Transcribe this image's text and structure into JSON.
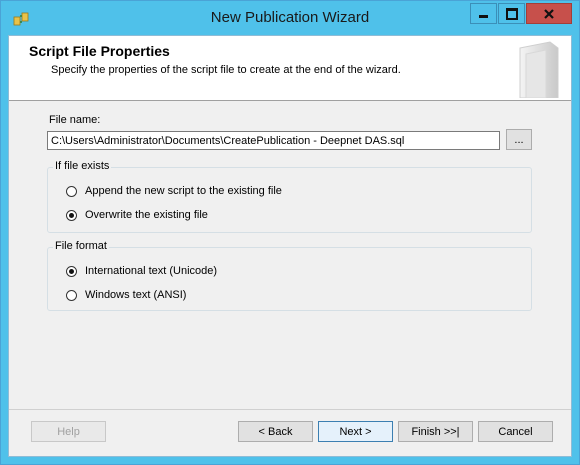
{
  "window": {
    "title": "New Publication Wizard",
    "icon": "sql-server-replication-icon"
  },
  "header": {
    "title": "Script File Properties",
    "subtitle": "Specify the properties of the script file to create at the end of the wizard."
  },
  "file": {
    "label": "File name:",
    "value": "C:\\Users\\Administrator\\Documents\\CreatePublication - Deepnet DAS.sql",
    "browse_label": "..."
  },
  "if_exists": {
    "legend": "If file exists",
    "options": [
      {
        "label": "Append the new script to the existing file",
        "checked": false
      },
      {
        "label": "Overwrite the existing file",
        "checked": true
      }
    ]
  },
  "file_format": {
    "legend": "File format",
    "options": [
      {
        "label": "International text (Unicode)",
        "checked": true
      },
      {
        "label": "Windows text (ANSI)",
        "checked": false
      }
    ]
  },
  "buttons": {
    "help": "Help",
    "back": "< Back",
    "next": "Next >",
    "finish": "Finish >>|",
    "cancel": "Cancel"
  },
  "colors": {
    "titlebar": "#4fc1ea",
    "close_button": "#c7504b"
  }
}
